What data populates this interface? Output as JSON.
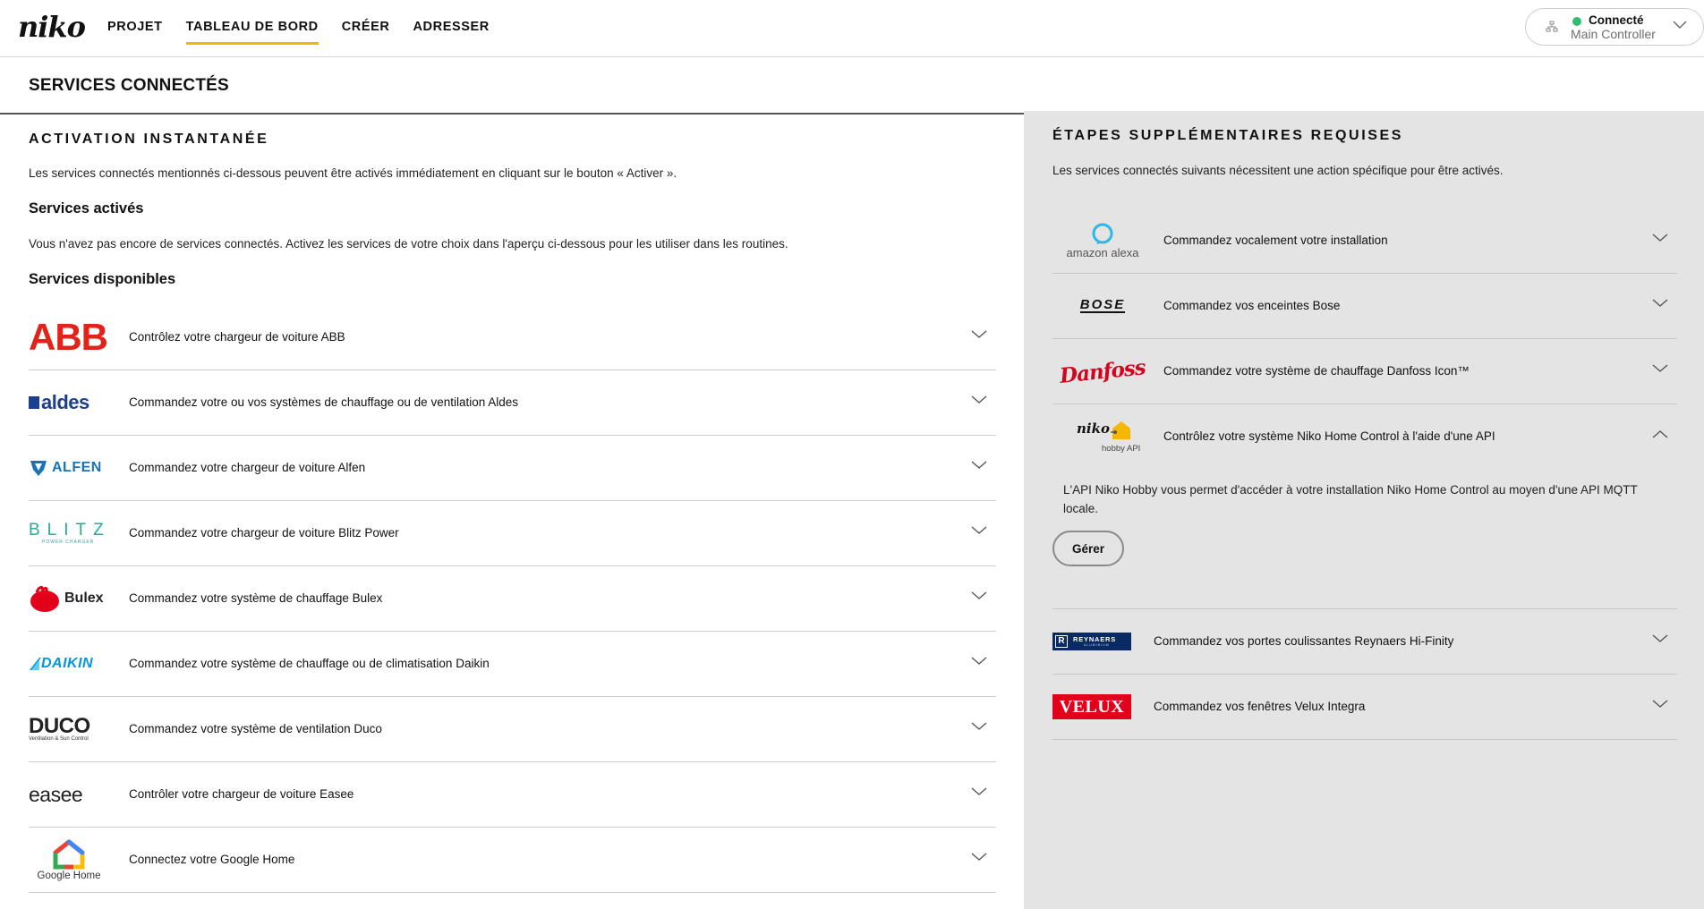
{
  "header": {
    "logo": "niko",
    "nav": [
      "PROJET",
      "TABLEAU DE BORD",
      "CRÉER",
      "ADRESSER"
    ],
    "active_nav": "TABLEAU DE BORD",
    "controller": {
      "status": "Connecté",
      "name": "Main Controller",
      "status_color": "#2fbf71"
    }
  },
  "page_title": "SERVICES CONNECTÉS",
  "instant": {
    "heading": "ACTIVATION INSTANTANÉE",
    "description": "Les services connectés mentionnés ci-dessous peuvent être activés immédiatement en cliquant sur le bouton « Activer ».",
    "activated_heading": "Services activés",
    "activated_empty": "Vous n'avez pas encore de services connectés. Activez les services de votre choix dans l'aperçu ci-dessous pour les utiliser dans les routines.",
    "available_heading": "Services disponibles",
    "services": [
      {
        "logo": "ABB",
        "label": "Contrôlez votre chargeur de voiture ABB"
      },
      {
        "logo": "aldes",
        "label": "Commandez votre ou vos systèmes de chauffage ou de ventilation Aldes"
      },
      {
        "logo": "ALFEN",
        "label": "Commandez votre chargeur de voiture Alfen"
      },
      {
        "logo": "BLITZ",
        "logo_sub": "POWER CHARGER",
        "label": "Commandez votre chargeur de voiture Blitz Power"
      },
      {
        "logo": "Bulex",
        "label": "Commandez votre système de chauffage Bulex"
      },
      {
        "logo": "DAIKIN",
        "label": "Commandez votre système de chauffage ou de climatisation Daikin"
      },
      {
        "logo": "DUCO",
        "logo_sub": "Ventilation & Sun Control",
        "label": "Commandez votre système de ventilation Duco"
      },
      {
        "logo": "easee",
        "label": "Contrôler votre chargeur de voiture Easee"
      },
      {
        "logo": "Google Home",
        "label": "Connectez votre Google Home"
      }
    ]
  },
  "extra": {
    "heading": "ÉTAPES SUPPLÉMENTAIRES REQUISES",
    "description": "Les services connectés suivants nécessitent une action spécifique pour être activés.",
    "services": [
      {
        "logo": "amazon alexa",
        "label": "Commandez vocalement votre installation"
      },
      {
        "logo": "BOSE",
        "label": "Commandez vos enceintes Bose"
      },
      {
        "logo": "Danfoss",
        "label": "Commandez votre système de chauffage Danfoss Icon™"
      },
      {
        "logo": "niko",
        "logo_sub": "hobby API",
        "label": "Contrôlez votre système Niko Home Control à l'aide d'une API",
        "expanded": true,
        "details": "L'API Niko Hobby vous permet d'accéder à votre installation Niko Home Control au moyen d'une API MQTT locale.",
        "button": "Gérer"
      },
      {
        "logo": "REYNAERS",
        "logo_sub": "ALUMINIUM",
        "label": "Commandez vos portes coulissantes Reynaers Hi-Finity"
      },
      {
        "logo": "VELUX",
        "label": "Commandez vos fenêtres Velux Integra"
      }
    ]
  },
  "colors": {
    "accent": "#f5b800",
    "abb": "#e2231a",
    "aldes": "#1d3f8f",
    "alfen": "#1a73b8",
    "blitz": "#2aa89a",
    "bulex": "#e3001b",
    "daikin": "#0097e0",
    "duco_o": "#7ab829",
    "danfoss": "#d2051e",
    "velux": "#e2001a",
    "reynaers": "#0a2a66",
    "alexa": "#2ab8e6"
  }
}
